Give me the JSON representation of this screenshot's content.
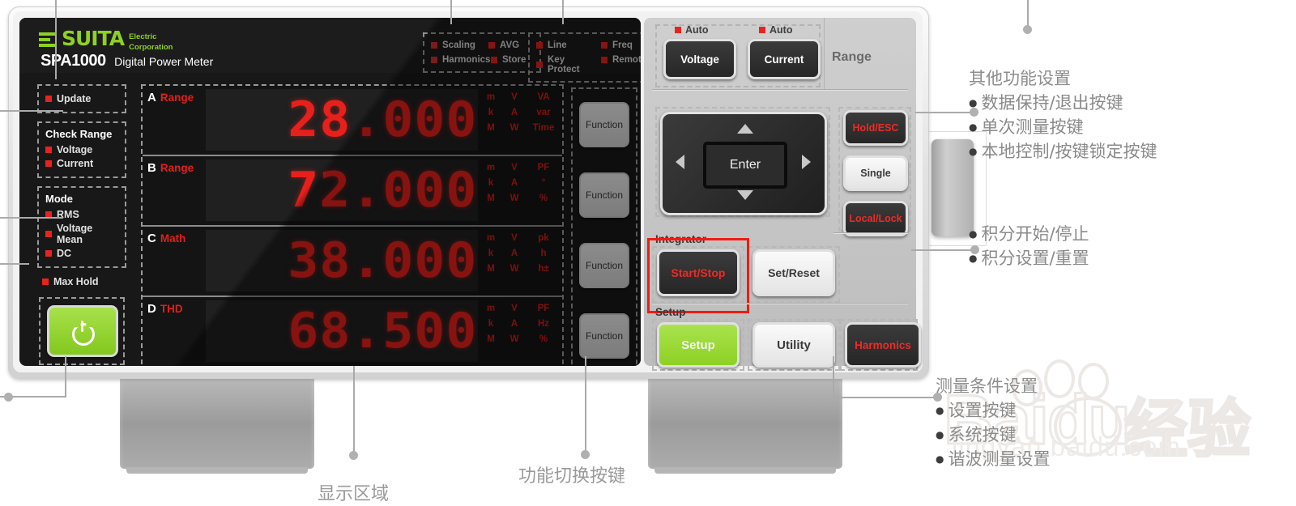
{
  "brand": {
    "name": "SUITA",
    "sub_line1": "Electric",
    "sub_line2": "Corporation",
    "model": "SPA1000",
    "model_desc": "Digital Power Meter",
    "accent_green": "#8ed123",
    "led_red": "#e8231f",
    "segment_red": "#e8201c"
  },
  "status_group_left": [
    {
      "label": "Scaling"
    },
    {
      "label": "AVG"
    },
    {
      "label": "Harmonics"
    },
    {
      "label": "Store"
    }
  ],
  "status_group_right": [
    {
      "label": "Line"
    },
    {
      "label": "Freq"
    },
    {
      "label": "Key Protect"
    },
    {
      "label": "Remote"
    }
  ],
  "left_panel": {
    "update": "Update",
    "check_range_title": "Check Range",
    "check_range_items": [
      "Voltage",
      "Current"
    ],
    "mode_title": "Mode",
    "mode_items": [
      "RMS",
      "Voltage Mean",
      "DC"
    ],
    "max_hold": "Max Hold",
    "power_icon": "power-icon"
  },
  "display": {
    "rows": [
      {
        "id": "A",
        "mode": "Range",
        "value": "28.000",
        "units": [
          [
            "m",
            "V",
            "VA"
          ],
          [
            "k",
            "A",
            "var"
          ],
          [
            "M",
            "W",
            "Time"
          ]
        ]
      },
      {
        "id": "B",
        "mode": "Range",
        "value": "72.000",
        "units": [
          [
            "m",
            "V",
            "PF"
          ],
          [
            "k",
            "A",
            "°"
          ],
          [
            "M",
            "W",
            "%"
          ]
        ]
      },
      {
        "id": "C",
        "mode": "Math",
        "value": "38.000",
        "units": [
          [
            "m",
            "V",
            "pk"
          ],
          [
            "k",
            "A",
            "h"
          ],
          [
            "M",
            "W",
            "h±"
          ]
        ]
      },
      {
        "id": "D",
        "mode": "THD",
        "value": "68.500",
        "units": [
          [
            "m",
            "V",
            "PF"
          ],
          [
            "k",
            "A",
            "Hz"
          ],
          [
            "M",
            "W",
            "%"
          ]
        ]
      }
    ]
  },
  "function_buttons": [
    "Function",
    "Function",
    "Function",
    "Function"
  ],
  "right_panel": {
    "auto_voltage": "Auto",
    "auto_current": "Auto",
    "voltage_button": "Voltage",
    "current_button": "Current",
    "range_label": "Range",
    "nav": {
      "enter": "Enter",
      "up": "arrow-up-icon",
      "down": "arrow-down-icon",
      "left": "arrow-left-icon",
      "right": "arrow-right-icon"
    },
    "side_buttons": [
      "Hold/ESC",
      "Single",
      "Local/Lock"
    ],
    "integrator_title": "Integrator",
    "integrator_buttons": [
      "Start/Stop",
      "Set/Reset"
    ],
    "setup_title": "Setup",
    "setup_buttons": [
      "Setup",
      "Utility",
      "Harmonics"
    ],
    "highlight_color": "#f01b12"
  },
  "annotations": {
    "other_functions": {
      "title": "其他功能设置",
      "items": [
        "数据保持/退出按键",
        "单次测量按键",
        "本地控制/按键锁定按键"
      ]
    },
    "integrator": {
      "items": [
        "积分开始/停止",
        "积分设置/重置"
      ]
    },
    "measure_conditions": {
      "title": "测量条件设置",
      "items": [
        "设置按键",
        "系统按键",
        "谐波测量设置"
      ]
    },
    "display_area": "显示区域",
    "function_switch": "功能切换按键"
  },
  "watermark": {
    "text": "Baidu",
    "text_cn": "经验",
    "url": "jingyan.baidu.com"
  }
}
